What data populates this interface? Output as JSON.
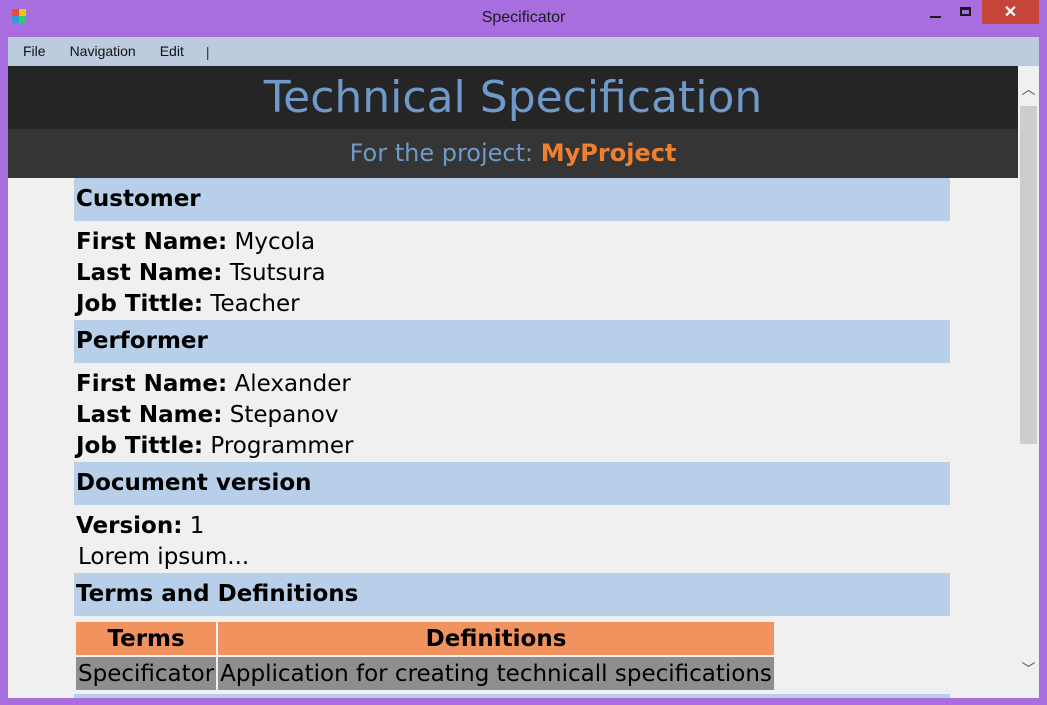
{
  "window": {
    "title": "Specificator"
  },
  "menu": {
    "items": [
      "File",
      "Navigation",
      "Edit"
    ],
    "separator": "|"
  },
  "header": {
    "title": "Technical Specification",
    "subtitle_prefix": "For the project:",
    "project_name": "MyProject"
  },
  "customer": {
    "heading": "Customer",
    "first_name_label": "First Name:",
    "first_name": "Mycola",
    "last_name_label": "Last Name:",
    "last_name": "Tsutsura",
    "job_label": "Job Tittle:",
    "job": "Teacher"
  },
  "performer": {
    "heading": "Performer",
    "first_name_label": "First Name:",
    "first_name": "Alexander",
    "last_name_label": "Last Name:",
    "last_name": "Stepanov",
    "job_label": "Job Tittle:",
    "job": "Programmer"
  },
  "version": {
    "heading": "Document version",
    "label": "Version:",
    "value": "1",
    "note": "Lorem ipsum..."
  },
  "terms": {
    "heading": "Terms and Definitions",
    "col_terms": "Terms",
    "col_definitions": "Definitions",
    "rows": [
      {
        "term": "Specificator",
        "definition": "Application for creating technicall specifications"
      }
    ]
  },
  "colors": {
    "frame": "#a86ee0",
    "header_bg": "#252525",
    "header_text": "#6f99c9",
    "project_accent": "#ef8030",
    "section_band": "#b8cfea",
    "table_head": "#f0935e",
    "table_cell": "#8e8e8e"
  },
  "icons": [
    "app-icon",
    "minimize-icon",
    "maximize-icon",
    "close-icon",
    "scroll-up-icon",
    "scroll-down-icon"
  ]
}
